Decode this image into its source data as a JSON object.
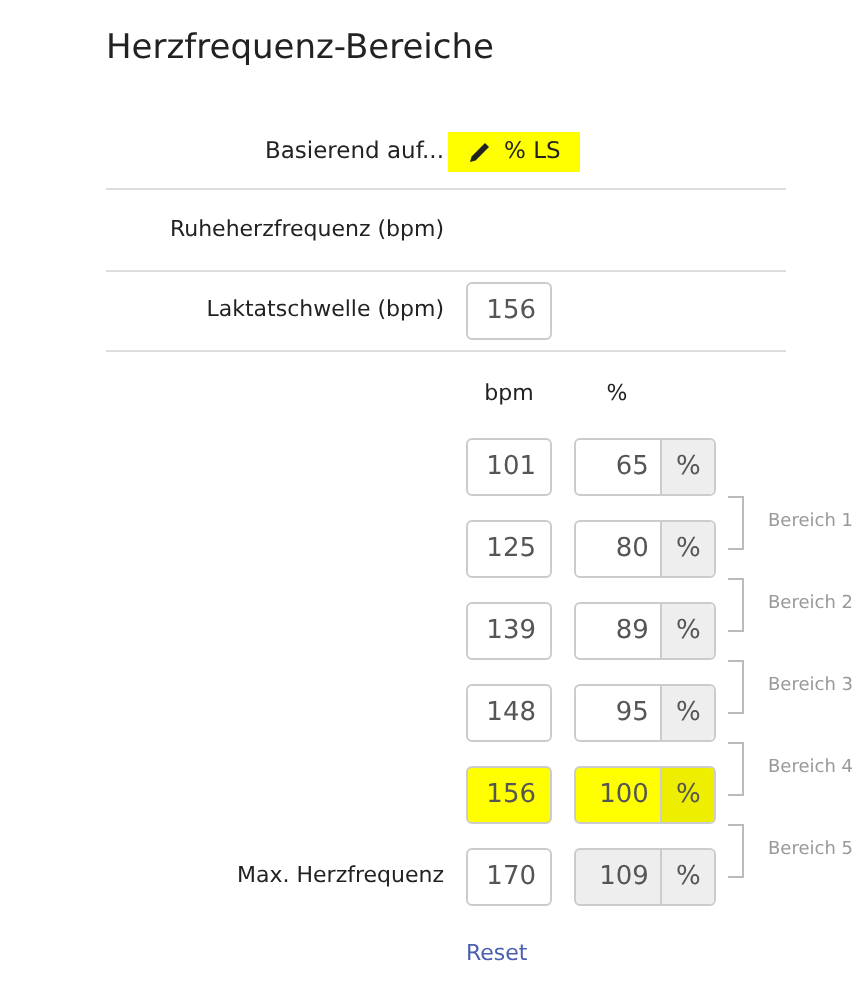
{
  "title": "Herzfrequenz-Bereiche",
  "basis": {
    "label": "Basierend auf...",
    "value": "% LS",
    "highlighted": true
  },
  "resting": {
    "label": "Ruheherzfrequenz (bpm)"
  },
  "threshold": {
    "label": "Laktatschwelle (bpm)",
    "value": "156"
  },
  "columns": [
    "bpm",
    "%"
  ],
  "rows": [
    {
      "bpm": "101",
      "percent": "65",
      "unit": "%",
      "highlighted": false,
      "disabled": false
    },
    {
      "bpm": "125",
      "percent": "80",
      "unit": "%",
      "highlighted": false,
      "disabled": false
    },
    {
      "bpm": "139",
      "percent": "89",
      "unit": "%",
      "highlighted": false,
      "disabled": false
    },
    {
      "bpm": "148",
      "percent": "95",
      "unit": "%",
      "highlighted": false,
      "disabled": false
    },
    {
      "bpm": "156",
      "percent": "100",
      "unit": "%",
      "highlighted": true,
      "disabled": false
    },
    {
      "label": "Max. Herzfrequenz",
      "bpm": "170",
      "percent": "109",
      "unit": "%",
      "highlighted": false,
      "disabled": true
    }
  ],
  "zones": [
    "Bereich 1",
    "Bereich 2",
    "Bereich 3",
    "Bereich 4",
    "Bereich 5"
  ],
  "reset": "Reset"
}
